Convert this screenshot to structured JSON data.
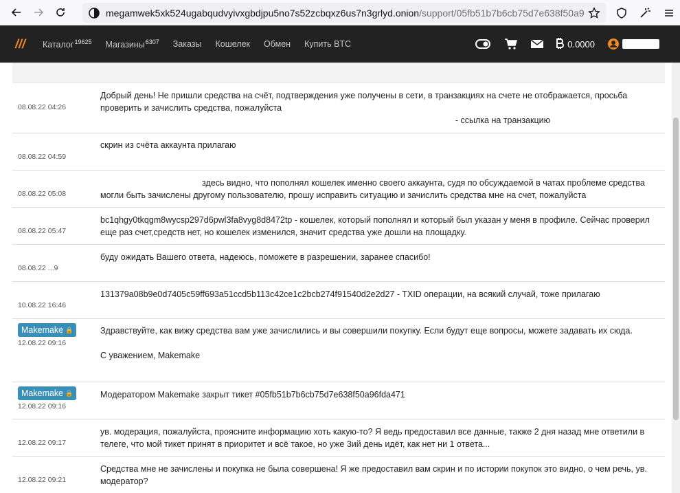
{
  "browser": {
    "url_host": "megamwek5xk524ugabqudvyivxgbdjpu5no7s52zcbqxz6us7n3grlyd.onion",
    "url_path": "/support/05fb51b7b6cb75d7e638f50a9"
  },
  "site": {
    "logo": "///",
    "nav": [
      {
        "label": "Каталог",
        "count": "19625"
      },
      {
        "label": "Магазины",
        "count": "6307"
      },
      {
        "label": "Заказы",
        "count": ""
      },
      {
        "label": "Кошелек",
        "count": ""
      },
      {
        "label": "Обмен",
        "count": ""
      },
      {
        "label": "Купить BTC",
        "count": ""
      }
    ],
    "balance": "0.0000"
  },
  "messages": [
    {
      "author": "",
      "date": "08.08.22 04:26",
      "lines": [
        "Добрый день! Не пришли средства на счёт, подтверждения уже получены в сети, в транзакциях на счете не отображается, просьба проверить и зачислить средства, пожалуйста"
      ],
      "extra": "- ссылка на транзакцию"
    },
    {
      "author": "",
      "date": "08.08.22 04:59",
      "lines": [
        "скрин из счёта аккаунта прилагаю"
      ],
      "extra": ""
    },
    {
      "author": "",
      "date": "08.08.22 05:08",
      "lines": [
        "здесь видно, что пополнял кошелек именно своего аккаунта, судя по обсуждаемой в чатах проблеме средства могли быть зачислены другому пользователю, прошу исправить ситуацию и зачислить средства мне на счет, пожалуйста"
      ],
      "extra": ""
    },
    {
      "author": "",
      "date": "08.08.22 05:47",
      "lines": [
        "bc1qhgy0tkqgm8wycsp297d6pwl3fa8vyg8d8472tp - кошелек, который пополнял и который был указан у меня в профиле. Сейчас проверил еще раз счет,средств нет, но кошелек изменился, значит средства уже дошли на площадку."
      ],
      "extra": ""
    },
    {
      "author": "",
      "date": "08.08.22 ...9",
      "lines": [
        "буду ожидать Вашего ответа, надеюсь, поможете в разрешении, заранее спасибо!"
      ],
      "extra": ""
    },
    {
      "author": "",
      "date": "10.08.22 16:46",
      "lines": [
        "131379a08b9e0d7405c59ff693a51ccd5b113c42ce1c2bcb274f91540d2e2d27 - TXID операции, на всякий случай, тоже прилагаю"
      ],
      "extra": ""
    },
    {
      "author": "Makemake",
      "date": "12.08.22 09:16",
      "lines": [
        "Здравствуйте, как вижу средства вам уже зачислились и вы совершили покупку. Если будут еще вопросы, можете задавать их сюда.",
        "",
        "С уважением, Makemake"
      ],
      "extra": ""
    },
    {
      "author": "Makemake",
      "date": "12.08.22 09:16",
      "lines": [
        "Модератором Makemake закрыт тикет #05fb51b7b6cb75d7e638f50a96fda471"
      ],
      "extra": ""
    },
    {
      "author": "",
      "date": "12.08.22 09:17",
      "lines": [
        "ув. модерация, пожалуйста, проясните информацию хоть какую-то? Я ведь предоставил все данные, также 2 дня назад мне ответили в телеге, что мой тикет принят в приоритет и всё такое, но уже 3ий день идёт, как нет ни 1 ответа..."
      ],
      "extra": ""
    },
    {
      "author": "",
      "date": "12.08.22 09:21",
      "lines": [
        "Средства мне не зачислены и покупка не была совершена! Я же предоставил вам скрин и по истории покупок это видно, о чем речь, ув. модератор?"
      ],
      "extra": ""
    }
  ]
}
